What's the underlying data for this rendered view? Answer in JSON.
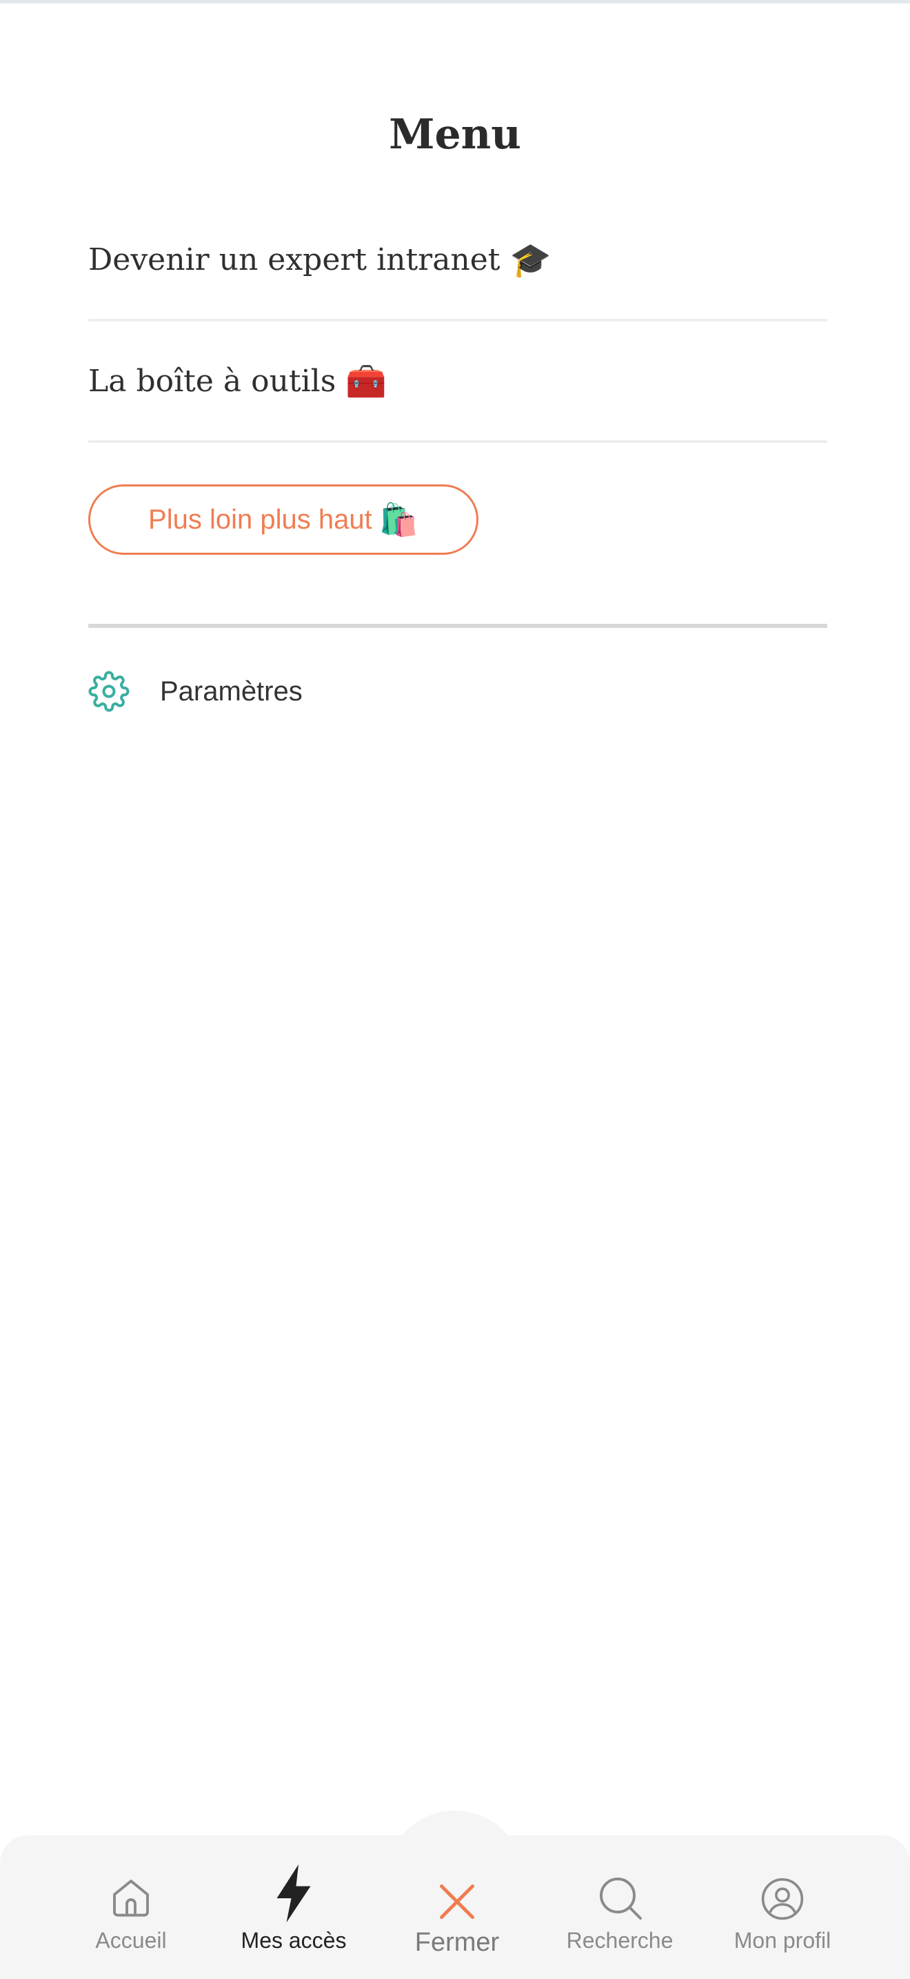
{
  "page": {
    "title": "Menu"
  },
  "menu": {
    "items": [
      {
        "label": "Devenir un expert intranet",
        "emoji": "🎓"
      },
      {
        "label": "La boîte à outils",
        "emoji": "🧰"
      }
    ],
    "highlight": {
      "label": "Plus loin plus haut",
      "emoji": "🛍️"
    },
    "settings": {
      "label": "Paramètres"
    }
  },
  "bottom_nav": {
    "items": [
      {
        "label": "Accueil",
        "icon": "home-icon"
      },
      {
        "label": "Mes accès",
        "icon": "lightning-icon",
        "active": true
      },
      {
        "label": "Fermer",
        "icon": "close-icon"
      },
      {
        "label": "Recherche",
        "icon": "search-icon"
      },
      {
        "label": "Mon profil",
        "icon": "profile-icon"
      }
    ]
  },
  "colors": {
    "accent": "#ef7d52",
    "teal": "#3aaea0",
    "text": "#2f2f2f",
    "nav_bg": "#f5f5f5"
  }
}
